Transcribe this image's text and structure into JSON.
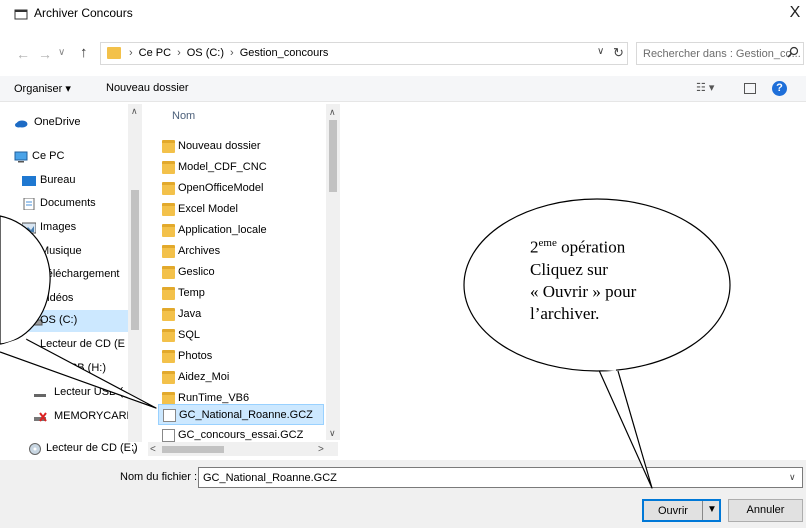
{
  "window": {
    "title": "Archiver Concours",
    "close_glyph": "X"
  },
  "address": {
    "breadcrumb": [
      "Ce PC",
      "OS (C:)",
      "Gestion_concours"
    ],
    "separator": "›",
    "search_placeholder": "Rechercher dans : Gestion_co..."
  },
  "toolbar": {
    "organiser": "Organiser ▾",
    "new_folder": "Nouveau dossier",
    "view_glyph": "☷ ▾"
  },
  "navpane": {
    "items": [
      {
        "label": "OneDrive",
        "icon": "cloud-icon"
      },
      {
        "label": "Ce PC",
        "icon": "computer-icon"
      },
      {
        "label": "Bureau",
        "icon": "desktop-icon"
      },
      {
        "label": "Documents",
        "icon": "documents-icon"
      },
      {
        "label": "Images",
        "icon": "images-icon"
      },
      {
        "label": "Musique",
        "icon": "music-icon"
      },
      {
        "label": "Téléchargement",
        "icon": "download-icon"
      },
      {
        "label": "Vidéos",
        "icon": "videos-icon"
      },
      {
        "label": "OS (C:)",
        "icon": "drive-icon"
      },
      {
        "label": "Lecteur de CD (E",
        "icon": "cd-drive-icon"
      },
      {
        "label": "USB (H:)",
        "icon": "usb-drive-icon"
      },
      {
        "label": "Lecteur USB (",
        "icon": "usb-drive-icon"
      },
      {
        "label": "MEMORYCARD",
        "icon": "memory-card-icon"
      },
      {
        "label": "Lecteur de CD (E:)",
        "icon": "cd-drive-icon"
      }
    ]
  },
  "filelist": {
    "column_header": "Nom",
    "files": [
      {
        "name": "Nouveau dossier",
        "type": "folder"
      },
      {
        "name": "Model_CDF_CNC",
        "type": "folder"
      },
      {
        "name": "OpenOfficeModel",
        "type": "folder"
      },
      {
        "name": "Excel Model",
        "type": "folder"
      },
      {
        "name": "Application_locale",
        "type": "folder"
      },
      {
        "name": "Archives",
        "type": "folder"
      },
      {
        "name": "Geslico",
        "type": "folder"
      },
      {
        "name": "Temp",
        "type": "folder"
      },
      {
        "name": "Java",
        "type": "folder"
      },
      {
        "name": "SQL",
        "type": "folder"
      },
      {
        "name": "Photos",
        "type": "folder"
      },
      {
        "name": "Aidez_Moi",
        "type": "folder"
      },
      {
        "name": "RunTime_VB6",
        "type": "folder"
      },
      {
        "name": "GC_National_Roanne.GCZ",
        "type": "file",
        "selected": true
      },
      {
        "name": "GC_concours_essai.GCZ",
        "type": "file"
      }
    ]
  },
  "bottom": {
    "filename_label": "Nom du fichier :",
    "filename_value": "GC_National_Roanne.GCZ",
    "open_label": "Ouvrir",
    "cancel_label": "Annuler"
  },
  "callout": {
    "line1_num": "2",
    "line1_sup": "eme",
    "line1_rest": " opération",
    "line2": "Cliquez sur",
    "line3": "« Ouvrir » pour",
    "line4": "l’archiver."
  },
  "colors": {
    "accent": "#0078d7",
    "selection": "#cce8ff",
    "folder": "#f3c14a",
    "help": "#1e6fd9"
  }
}
